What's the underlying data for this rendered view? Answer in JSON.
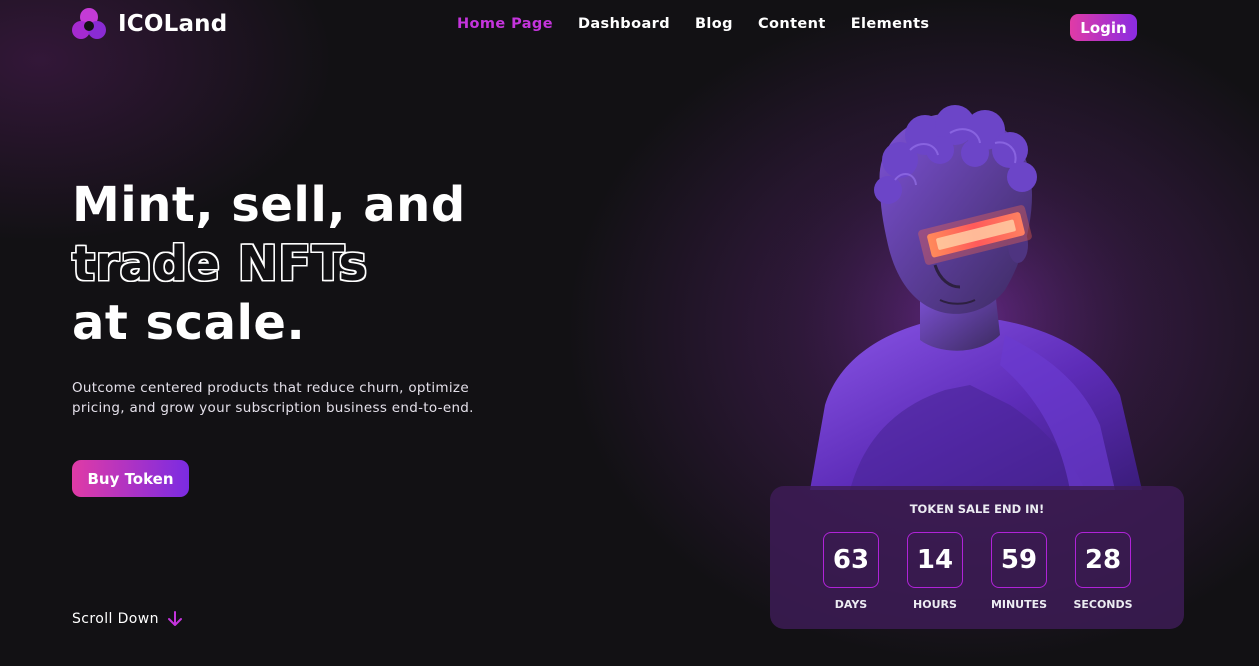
{
  "brand": {
    "name": "ICOLand",
    "colors": {
      "accent": "#c434dc",
      "gradient_start": "#e03ba6",
      "gradient_end": "#8a2be2",
      "background": "#121114"
    }
  },
  "nav": {
    "items": [
      {
        "label": "Home Page",
        "active": true
      },
      {
        "label": "Dashboard",
        "active": false
      },
      {
        "label": "Blog",
        "active": false
      },
      {
        "label": "Content",
        "active": false
      },
      {
        "label": "Elements",
        "active": false
      }
    ]
  },
  "header": {
    "login_label": "Login"
  },
  "hero": {
    "title_line1": "Mint, sell, and",
    "title_line2": "trade NFTs",
    "title_line3": "at scale.",
    "description": "Outcome centered products that reduce churn, optimize pricing, and grow your subscription business end-to-end.",
    "buy_label": "Buy Token",
    "scroll_label": "Scroll Down",
    "scroll_icon": "arrow-down-icon"
  },
  "countdown": {
    "title": "TOKEN SALE END IN!",
    "units": [
      {
        "value": "63",
        "label": "DAYS"
      },
      {
        "value": "14",
        "label": "HOURS"
      },
      {
        "value": "59",
        "label": "MINUTES"
      },
      {
        "value": "28",
        "label": "SECONDS"
      }
    ]
  }
}
